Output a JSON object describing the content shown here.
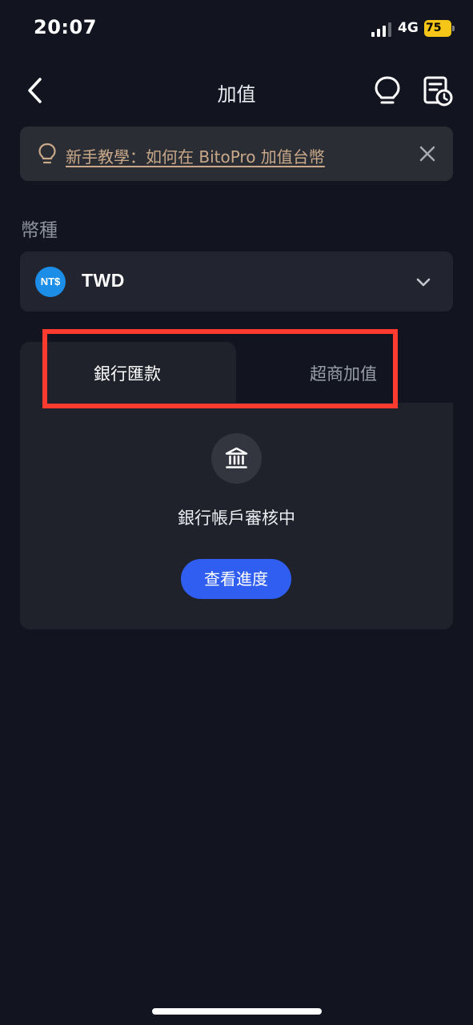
{
  "status_bar": {
    "time": "20:07",
    "network": "4G",
    "battery": "75"
  },
  "header": {
    "title": "加值"
  },
  "banner": {
    "text": "新手教學：如何在 BitoPro 加值台幣"
  },
  "currency": {
    "label": "幣種",
    "icon_text": "NT$",
    "code": "TWD"
  },
  "tabs": [
    {
      "label": "銀行匯款",
      "active": true
    },
    {
      "label": "超商加值",
      "active": false
    }
  ],
  "bank_status": {
    "message": "銀行帳戶審核中",
    "button_label": "查看進度"
  },
  "colors": {
    "background": "#12151f",
    "card": "#1f222a",
    "accent_button": "#2f5ef0",
    "banner_link": "#c9a98a",
    "highlight": "#ff3b30"
  },
  "icons": {
    "back": "chevron-left-icon",
    "tips": "lightbulb-icon",
    "history": "history-document-icon",
    "close": "close-icon",
    "dropdown": "chevron-down-icon",
    "bank": "bank-icon"
  }
}
